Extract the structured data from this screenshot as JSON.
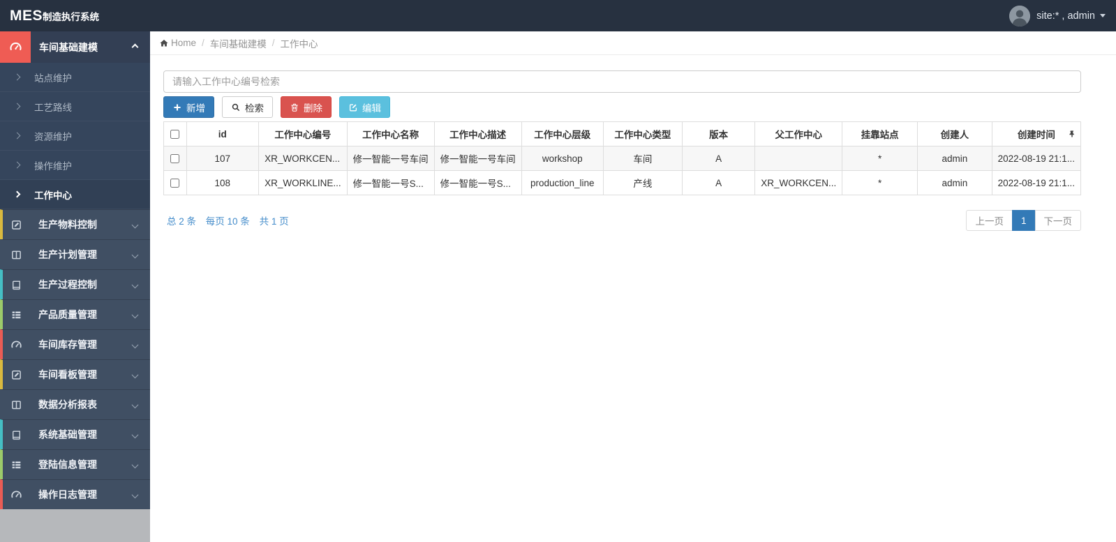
{
  "app": {
    "title_bold": "MES",
    "title_rest": "制造执行系统",
    "user_label": "site:* , admin"
  },
  "breadcrumb": {
    "home": "Home",
    "level1": "车间基础建模",
    "level2": "工作中心"
  },
  "sidebar": {
    "items": [
      {
        "label": "车间基础建模",
        "icon": "dashboard-icon",
        "state": "active-expanded"
      },
      {
        "label": "生产物料控制",
        "icon": "edit-icon",
        "strip_style": "border-left-color:#d9b93f"
      },
      {
        "label": "生产计划管理",
        "icon": "columns-icon",
        "strip_style": "border-left-color:transparent"
      },
      {
        "label": "生产过程控制",
        "icon": "book-icon",
        "strip_style": "border-left-color:#45bec4"
      },
      {
        "label": "产品质量管理",
        "icon": "th-list-icon",
        "strip_style": "border-left-color:#9ccb6a"
      },
      {
        "label": "车间库存管理",
        "icon": "dashboard-icon",
        "strip_style": "border-left-color:#ea5c55"
      },
      {
        "label": "车间看板管理",
        "icon": "edit-icon",
        "strip_style": "border-left-color:#d9b93f"
      },
      {
        "label": "数据分析报表",
        "icon": "columns-icon",
        "strip_style": "border-left-color:transparent"
      },
      {
        "label": "系统基础管理",
        "icon": "book-icon",
        "strip_style": "border-left-color:#45bec4"
      },
      {
        "label": "登陆信息管理",
        "icon": "th-list-icon",
        "strip_style": "border-left-color:#9ccb6a"
      },
      {
        "label": "操作日志管理",
        "icon": "dashboard-icon",
        "strip_style": "border-left-color:#ea5c55"
      }
    ],
    "submenu": [
      {
        "label": "站点维护",
        "active": false
      },
      {
        "label": "工艺路线",
        "active": false
      },
      {
        "label": "资源维护",
        "active": false
      },
      {
        "label": "操作维护",
        "active": false
      },
      {
        "label": "工作中心",
        "active": true
      }
    ]
  },
  "toolbar": {
    "search_placeholder": "请输入工作中心编号检索",
    "add_label": "新增",
    "search_label": "检索",
    "delete_label": "删除",
    "edit_label": "编辑"
  },
  "table": {
    "headers": [
      "id",
      "工作中心编号",
      "工作中心名称",
      "工作中心描述",
      "工作中心层级",
      "工作中心类型",
      "版本",
      "父工作中心",
      "挂靠站点",
      "创建人",
      "创建时间"
    ],
    "rows": [
      {
        "cells": [
          "107",
          "XR_WORKCEN...",
          "修一智能一号车间",
          "修一智能一号车间",
          "workshop",
          "车间",
          "A",
          "",
          "*",
          "admin",
          "2022-08-19 21:1..."
        ]
      },
      {
        "cells": [
          "108",
          "XR_WORKLINE...",
          "修一智能一号S...",
          "修一智能一号S...",
          "production_line",
          "产线",
          "A",
          "XR_WORKCEN...",
          "*",
          "admin",
          "2022-08-19 21:1..."
        ]
      }
    ]
  },
  "pagination": {
    "summary_total": "总 2 条",
    "summary_per_page": "每页 10 条",
    "summary_pages": "共 1 页",
    "prev_label": "上一页",
    "current_page": "1",
    "next_label": "下一页"
  },
  "colors": {
    "topbar_bg": "#273140",
    "sidebar_bg": "#404f63",
    "submenu_bg": "#35455c",
    "active_accent_red": "#ef5c54",
    "strip_yellow": "#d9b93f",
    "strip_teal": "#45bec4",
    "strip_green": "#9ccb6a",
    "strip_red": "#ea5c55",
    "primary_blue": "#337ab7",
    "danger_red": "#d9534f",
    "info_blue": "#5bc0de",
    "link_blue": "#428bca"
  }
}
